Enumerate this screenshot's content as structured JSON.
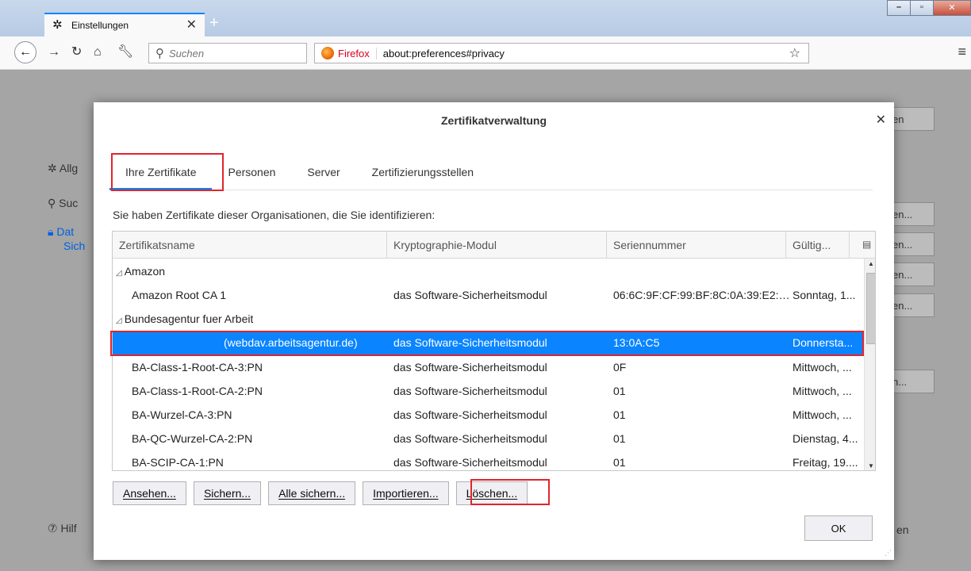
{
  "browser": {
    "tab_title": "Einstellungen",
    "search_placeholder": "Suchen",
    "identity_label": "Firefox",
    "url": "about:preferences#privacy"
  },
  "prefs_background": {
    "sidebar": [
      "Allg",
      "Suc",
      "Dat",
      "Sich",
      "Hilf"
    ],
    "right_buttons": [
      "en",
      "en...",
      "en...",
      "en...",
      "en...",
      "n...",
      "en"
    ]
  },
  "dialog": {
    "title": "Zertifikatverwaltung",
    "tabs": [
      {
        "label": "Ihre Zertifikate",
        "active": true
      },
      {
        "label": "Personen",
        "active": false
      },
      {
        "label": "Server",
        "active": false
      },
      {
        "label": "Zertifizierungsstellen",
        "active": false
      }
    ],
    "intro": "Sie haben Zertifikate dieser Organisationen, die Sie identifizieren:",
    "columns": [
      "Zertifikatsname",
      "Kryptographie-Modul",
      "Seriennummer",
      "Gültig..."
    ],
    "rows": [
      {
        "type": "group",
        "name": "Amazon"
      },
      {
        "type": "item",
        "name": "Amazon Root CA 1",
        "module": "das Software-Sicherheitsmodul",
        "serial": "06:6C:9F:CF:99:BF:8C:0A:39:E2:F...",
        "valid": "Sonntag, 1..."
      },
      {
        "type": "group",
        "name": "Bundesagentur fuer Arbeit"
      },
      {
        "type": "item",
        "name": "(webdav.arbeitsagentur.de)",
        "module": "das Software-Sicherheitsmodul",
        "serial": "13:0A:C5",
        "valid": "Donnersta...",
        "selected": true
      },
      {
        "type": "item",
        "name": "BA-Class-1-Root-CA-3:PN",
        "module": "das Software-Sicherheitsmodul",
        "serial": "0F",
        "valid": "Mittwoch, ..."
      },
      {
        "type": "item",
        "name": "BA-Class-1-Root-CA-2:PN",
        "module": "das Software-Sicherheitsmodul",
        "serial": "01",
        "valid": "Mittwoch, ..."
      },
      {
        "type": "item",
        "name": "BA-Wurzel-CA-3:PN",
        "module": "das Software-Sicherheitsmodul",
        "serial": "01",
        "valid": "Mittwoch, ..."
      },
      {
        "type": "item",
        "name": "BA-QC-Wurzel-CA-2:PN",
        "module": "das Software-Sicherheitsmodul",
        "serial": "01",
        "valid": "Dienstag, 4..."
      },
      {
        "type": "item",
        "name": "BA-SCIP-CA-1:PN",
        "module": "das Software-Sicherheitsmodul",
        "serial": "01",
        "valid": "Freitag, 19...."
      }
    ],
    "buttons": [
      "Ansehen...",
      "Sichern...",
      "Alle sichern...",
      "Importieren...",
      "Löschen..."
    ],
    "ok_label": "OK"
  },
  "colors": {
    "accent": "#0a84ff",
    "highlight": "#e3242b"
  }
}
